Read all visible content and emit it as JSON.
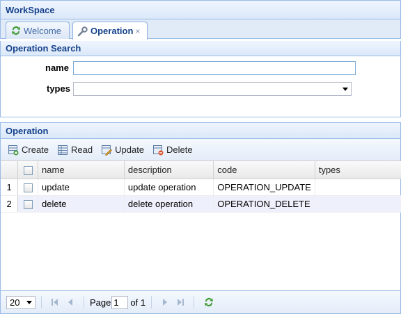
{
  "workspace": {
    "title": "WorkSpace"
  },
  "tabs": [
    {
      "label": "Welcome",
      "icon": "refresh-icon"
    },
    {
      "label": "Operation",
      "icon": "wrench-icon",
      "close": "×"
    }
  ],
  "search": {
    "title": "Operation Search",
    "name_label": "name",
    "name_value": "",
    "types_label": "types",
    "types_value": ""
  },
  "operation": {
    "title": "Operation",
    "toolbar": {
      "create": "Create",
      "read": "Read",
      "update": "Update",
      "delete": "Delete"
    },
    "columns": [
      "name",
      "description",
      "code",
      "types"
    ],
    "rows": [
      {
        "num": "1",
        "name": "update",
        "description": "update operation",
        "code": "OPERATION_UPDATE",
        "types": ""
      },
      {
        "num": "2",
        "name": "delete",
        "description": "delete operation",
        "code": "OPERATION_DELETE",
        "types": ""
      }
    ]
  },
  "pager": {
    "page_size": "20",
    "page_label": "Page",
    "page_value": "1",
    "of_label": "of 1"
  },
  "colors": {
    "header_text": "#15428b",
    "border": "#99bbe8",
    "alt_row": "#eef0fb"
  }
}
